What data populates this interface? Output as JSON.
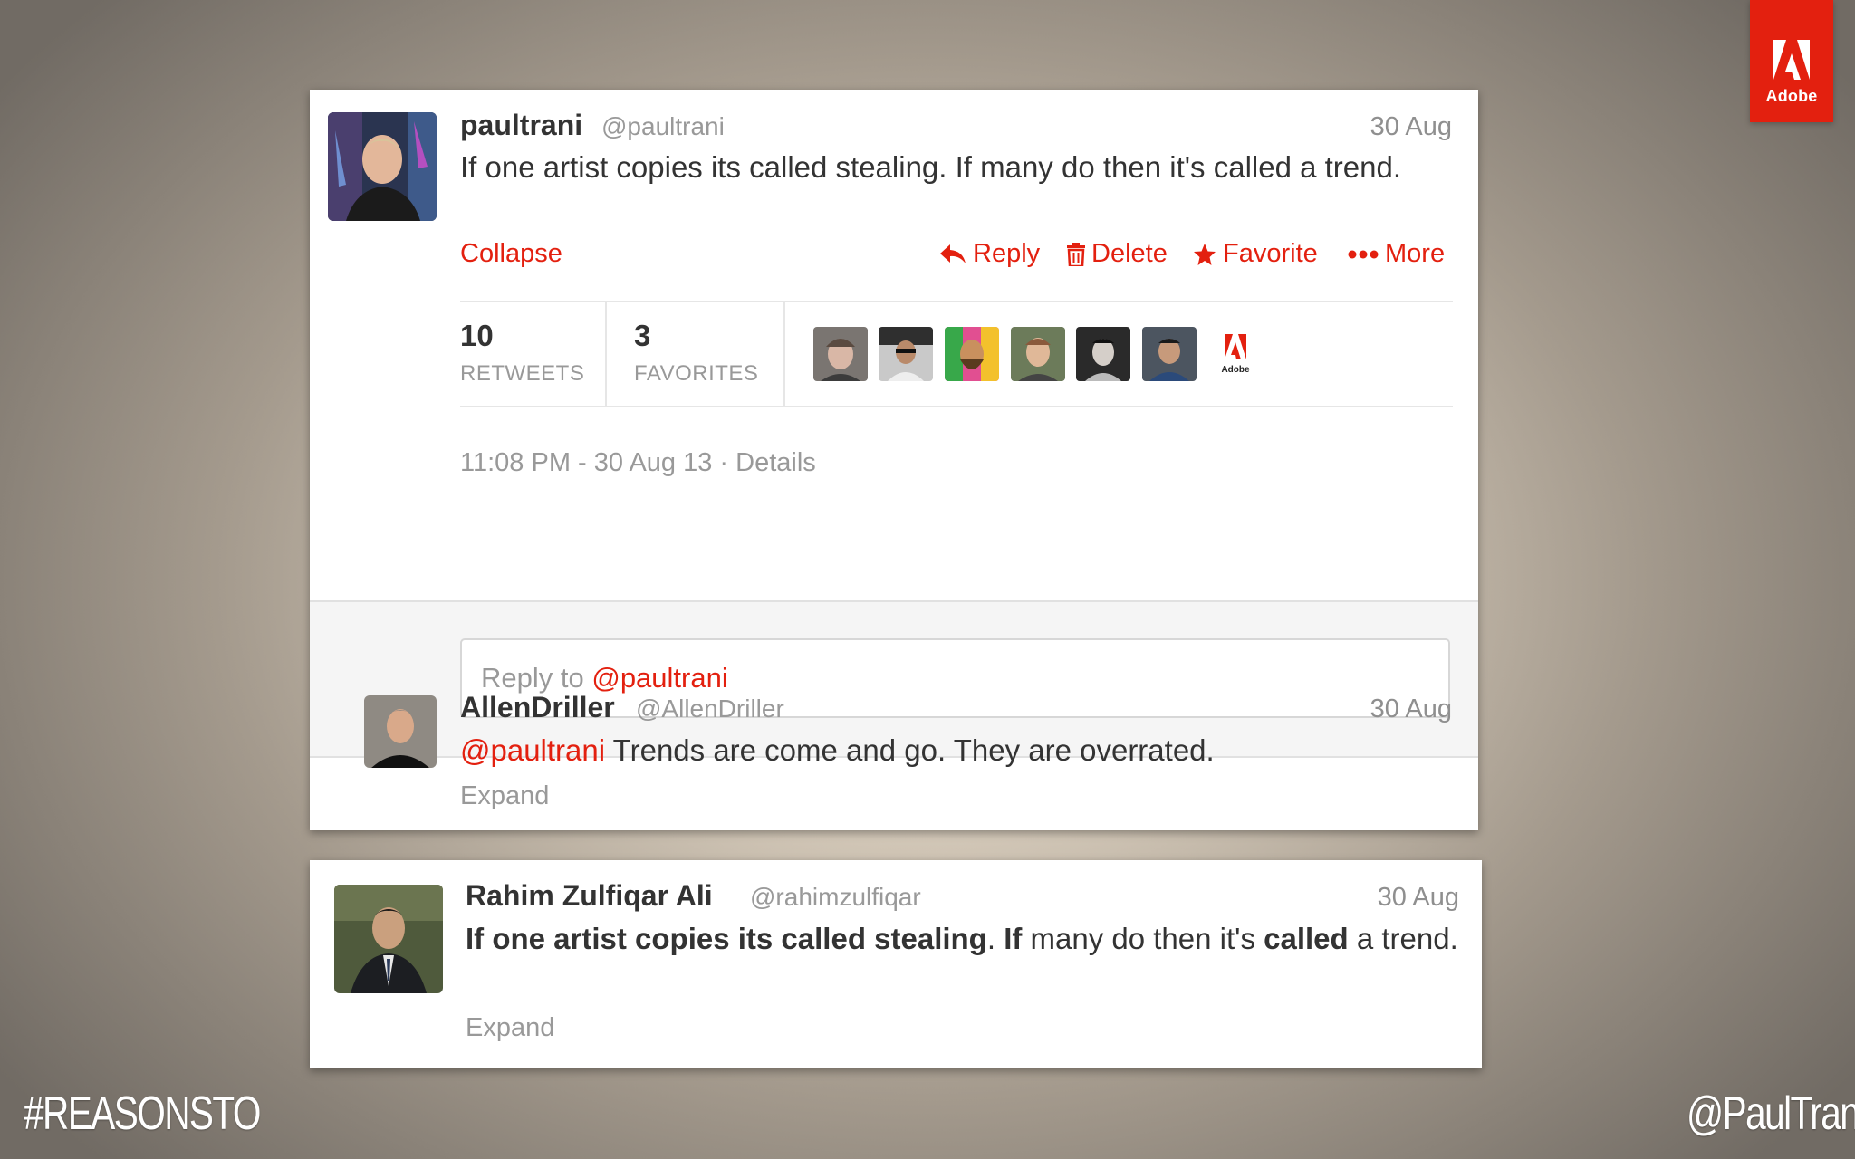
{
  "brand": {
    "name": "Adobe",
    "color": "#e3200f"
  },
  "main_tweet": {
    "name": "paultrani",
    "handle": "@paultrani",
    "date": "30 Aug",
    "text": "If one artist copies its called stealing. If many do then it's called a trend.",
    "actions": {
      "collapse": "Collapse",
      "reply": "Reply",
      "delete": "Delete",
      "favorite": "Favorite",
      "more": "More"
    },
    "stats": {
      "retweets_count": "10",
      "retweets_label": "RETWEETS",
      "favorites_count": "3",
      "favorites_label": "FAVORITES"
    },
    "engagers": [
      "avatar",
      "avatar",
      "avatar",
      "avatar",
      "avatar",
      "avatar",
      "Adobe"
    ],
    "timestamp": "11:08 PM - 30 Aug 13",
    "details": "Details"
  },
  "reply_box": {
    "prefix": "Reply to ",
    "mention": "@paultrani"
  },
  "reply_tweet": {
    "name": "AllenDriller",
    "handle": "@AllenDriller",
    "date": "30 Aug",
    "mention": "@paultrani",
    "text": " Trends are come and go. They are overrated.",
    "expand": "Expand"
  },
  "search_tweet": {
    "name": "Rahim Zulfiqar Ali",
    "handle": "@rahimzulfiqar",
    "date": "30 Aug",
    "segments": [
      {
        "text": "If one artist copies its called stealing",
        "bold": true
      },
      {
        "text": ". ",
        "bold": false
      },
      {
        "text": "If",
        "bold": true
      },
      {
        "text": " many do then it's ",
        "bold": false
      },
      {
        "text": "called",
        "bold": true
      },
      {
        "text": " a trend.",
        "bold": false
      }
    ],
    "expand": "Expand"
  },
  "footer": {
    "hashtag": "#REASONSTO",
    "twitter_handle": "@PaulTrani"
  }
}
